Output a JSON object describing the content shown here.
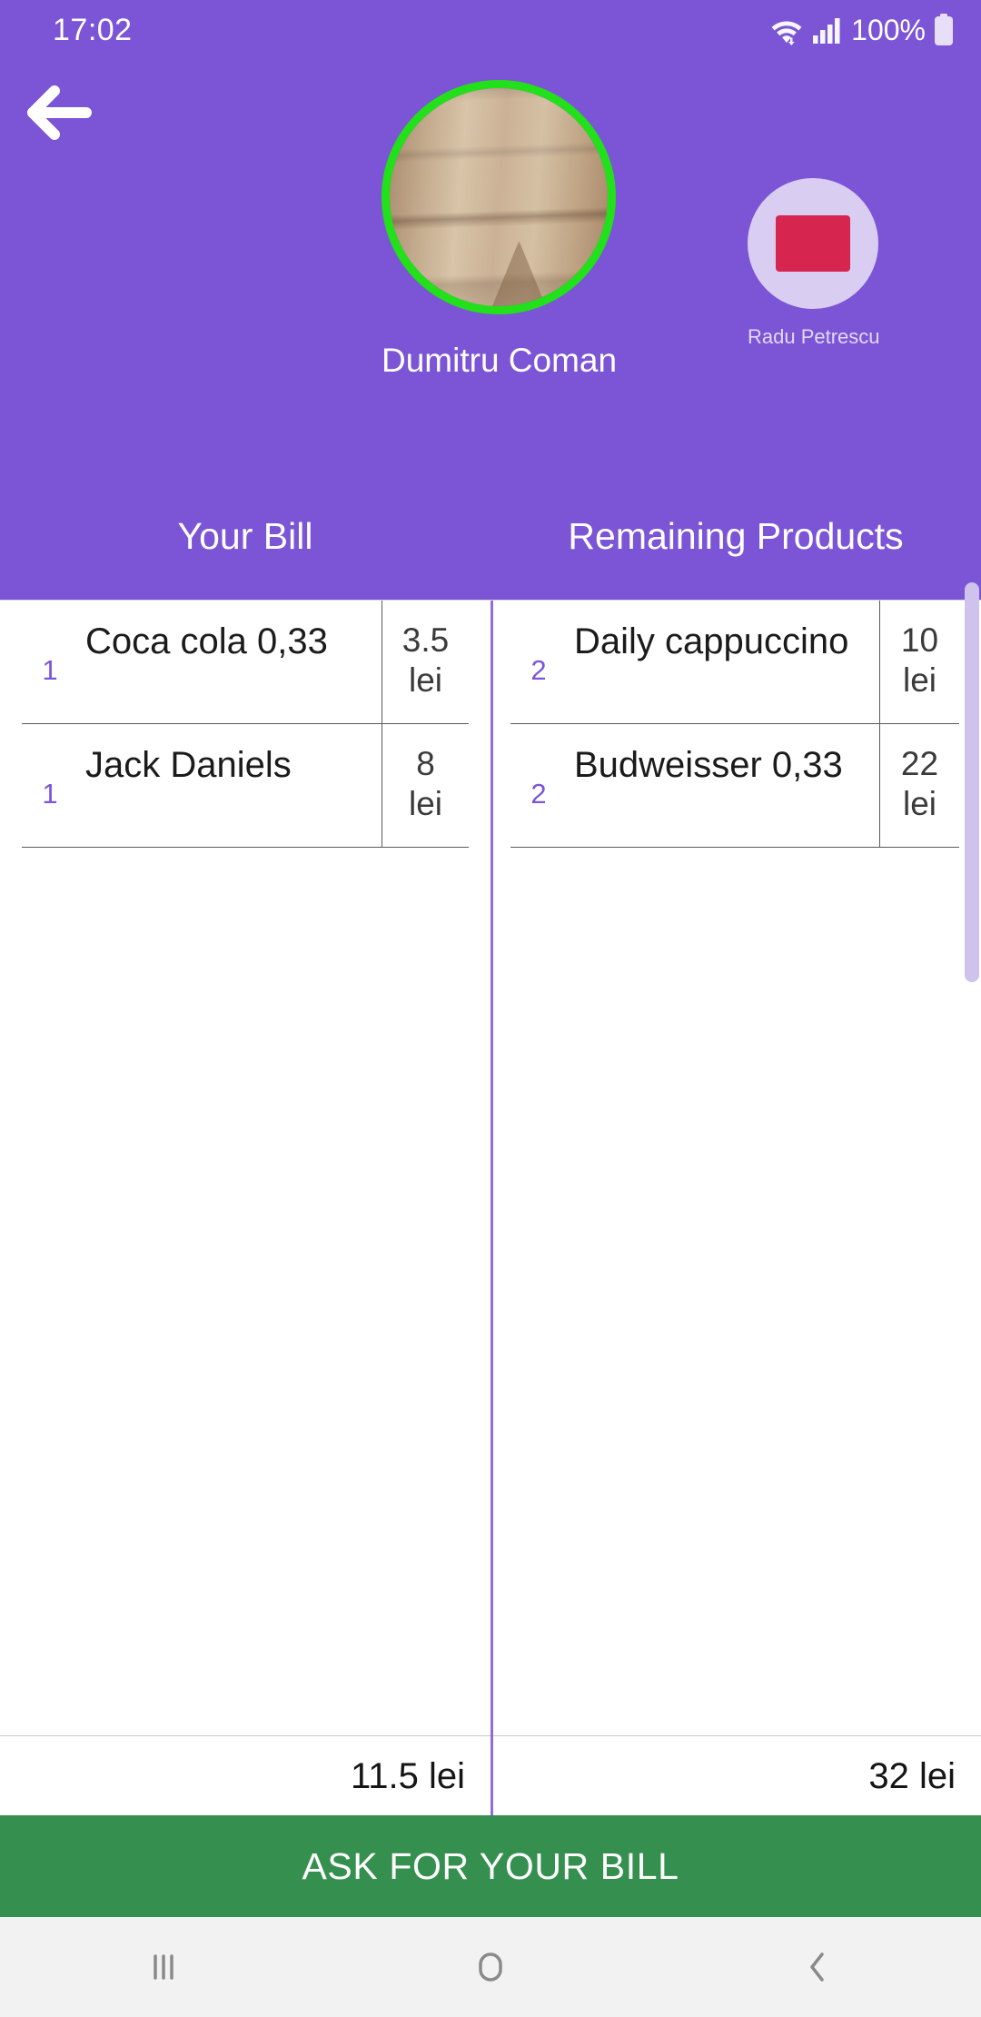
{
  "status_bar": {
    "time": "17:02",
    "battery_text": "100%",
    "icons": [
      "wifi-icon",
      "cellular-signal-icon",
      "battery-icon"
    ]
  },
  "header": {
    "back_icon": "back-arrow-icon",
    "main_user": {
      "name": "Dumitru Coman",
      "avatar_ring_color": "#22E019",
      "avatar_type": "photo"
    },
    "other_users": [
      {
        "name": "Radu Petrescu",
        "avatar_bg_color": "#D9CDF2",
        "avatar_shape_color": "#D6254F"
      }
    ],
    "background_color": "#7B55D6"
  },
  "columns": [
    {
      "title": "Your Bill",
      "items": [
        {
          "qty": "1",
          "name": "Coca cola 0,33",
          "price": "3.5",
          "currency": "lei"
        },
        {
          "qty": "1",
          "name": "Jack Daniels",
          "price": "8",
          "currency": "lei"
        }
      ],
      "total": "11.5 lei"
    },
    {
      "title": "Remaining Products",
      "items": [
        {
          "qty": "2",
          "name": "Daily cappuccino",
          "price": "10",
          "currency": "lei"
        },
        {
          "qty": "2",
          "name": "Budweisser 0,33",
          "price": "22",
          "currency": "lei"
        }
      ],
      "total": "32 lei"
    }
  ],
  "cta": {
    "label": "ASK FOR YOUR BILL",
    "color": "#35904F"
  },
  "nav_bar": {
    "recents_icon": "recents-icon",
    "home_icon": "home-icon",
    "back_icon": "back-chevron-icon"
  },
  "accent_colors": {
    "purple": "#7B55D6",
    "green_button": "#35904F",
    "avatar_ring_green": "#22E019",
    "quantity_purple": "#7B55D6"
  }
}
